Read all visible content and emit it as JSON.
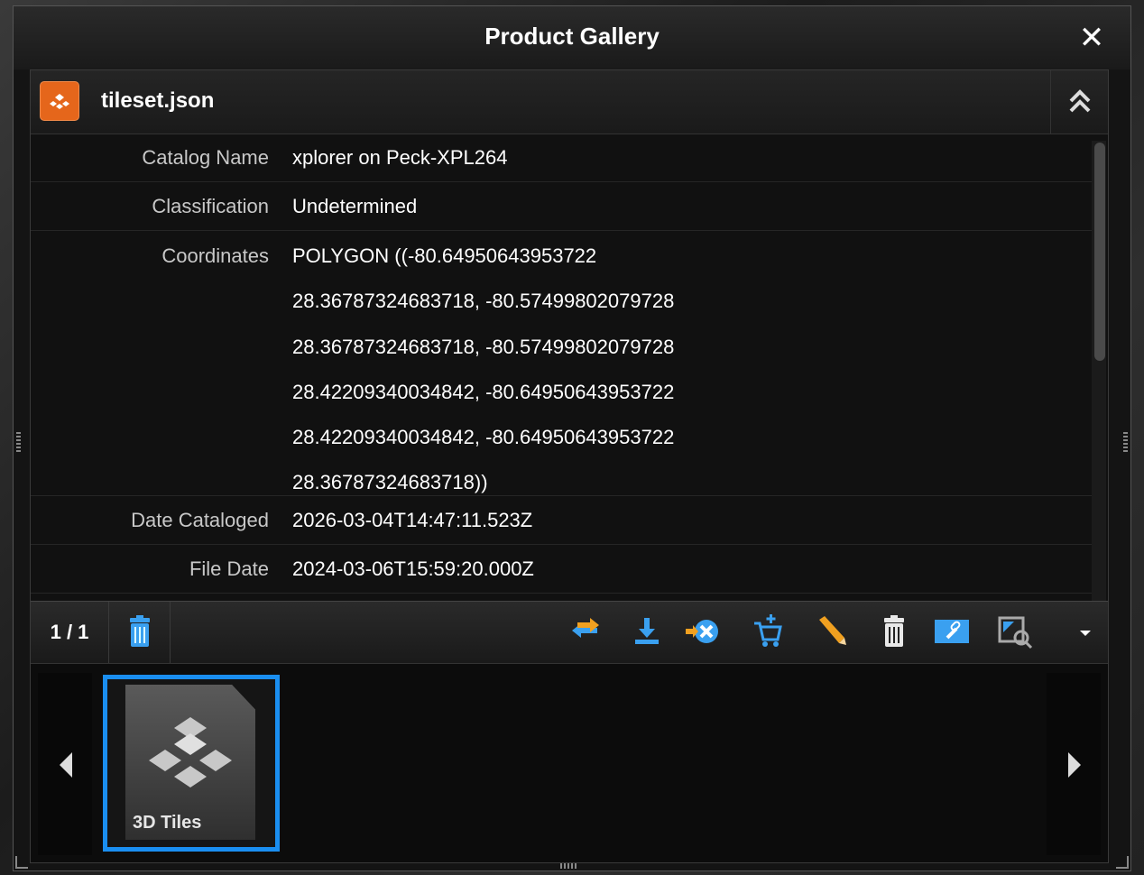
{
  "window": {
    "title": "Product Gallery"
  },
  "product": {
    "name": "tileset.json"
  },
  "details": [
    {
      "label": "Catalog Name",
      "value": "xplorer on Peck-XPL264"
    },
    {
      "label": "Classification",
      "value": "Undetermined"
    },
    {
      "label": "Coordinates",
      "value_lines": [
        "POLYGON ((-80.64950643953722",
        "28.36787324683718, -80.57499802079728",
        "28.36787324683718, -80.57499802079728",
        "28.42209340034842, -80.64950643953722",
        "28.42209340034842, -80.64950643953722",
        "28.36787324683718))"
      ]
    },
    {
      "label": "Date Cataloged",
      "value": "2026-03-04T14:47:11.523Z"
    },
    {
      "label": "File Date",
      "value": "2024-03-06T15:59:20.000Z"
    }
  ],
  "toolbar": {
    "page_counter": "1 / 1"
  },
  "thumbnails": [
    {
      "label": "3D Tiles",
      "selected": true
    }
  ],
  "colors": {
    "accent": "#1a8ef0",
    "product_icon": "#e5661b",
    "toolbar_icon_blue": "#3aa0f0",
    "toolbar_icon_orange": "#f0a020"
  }
}
